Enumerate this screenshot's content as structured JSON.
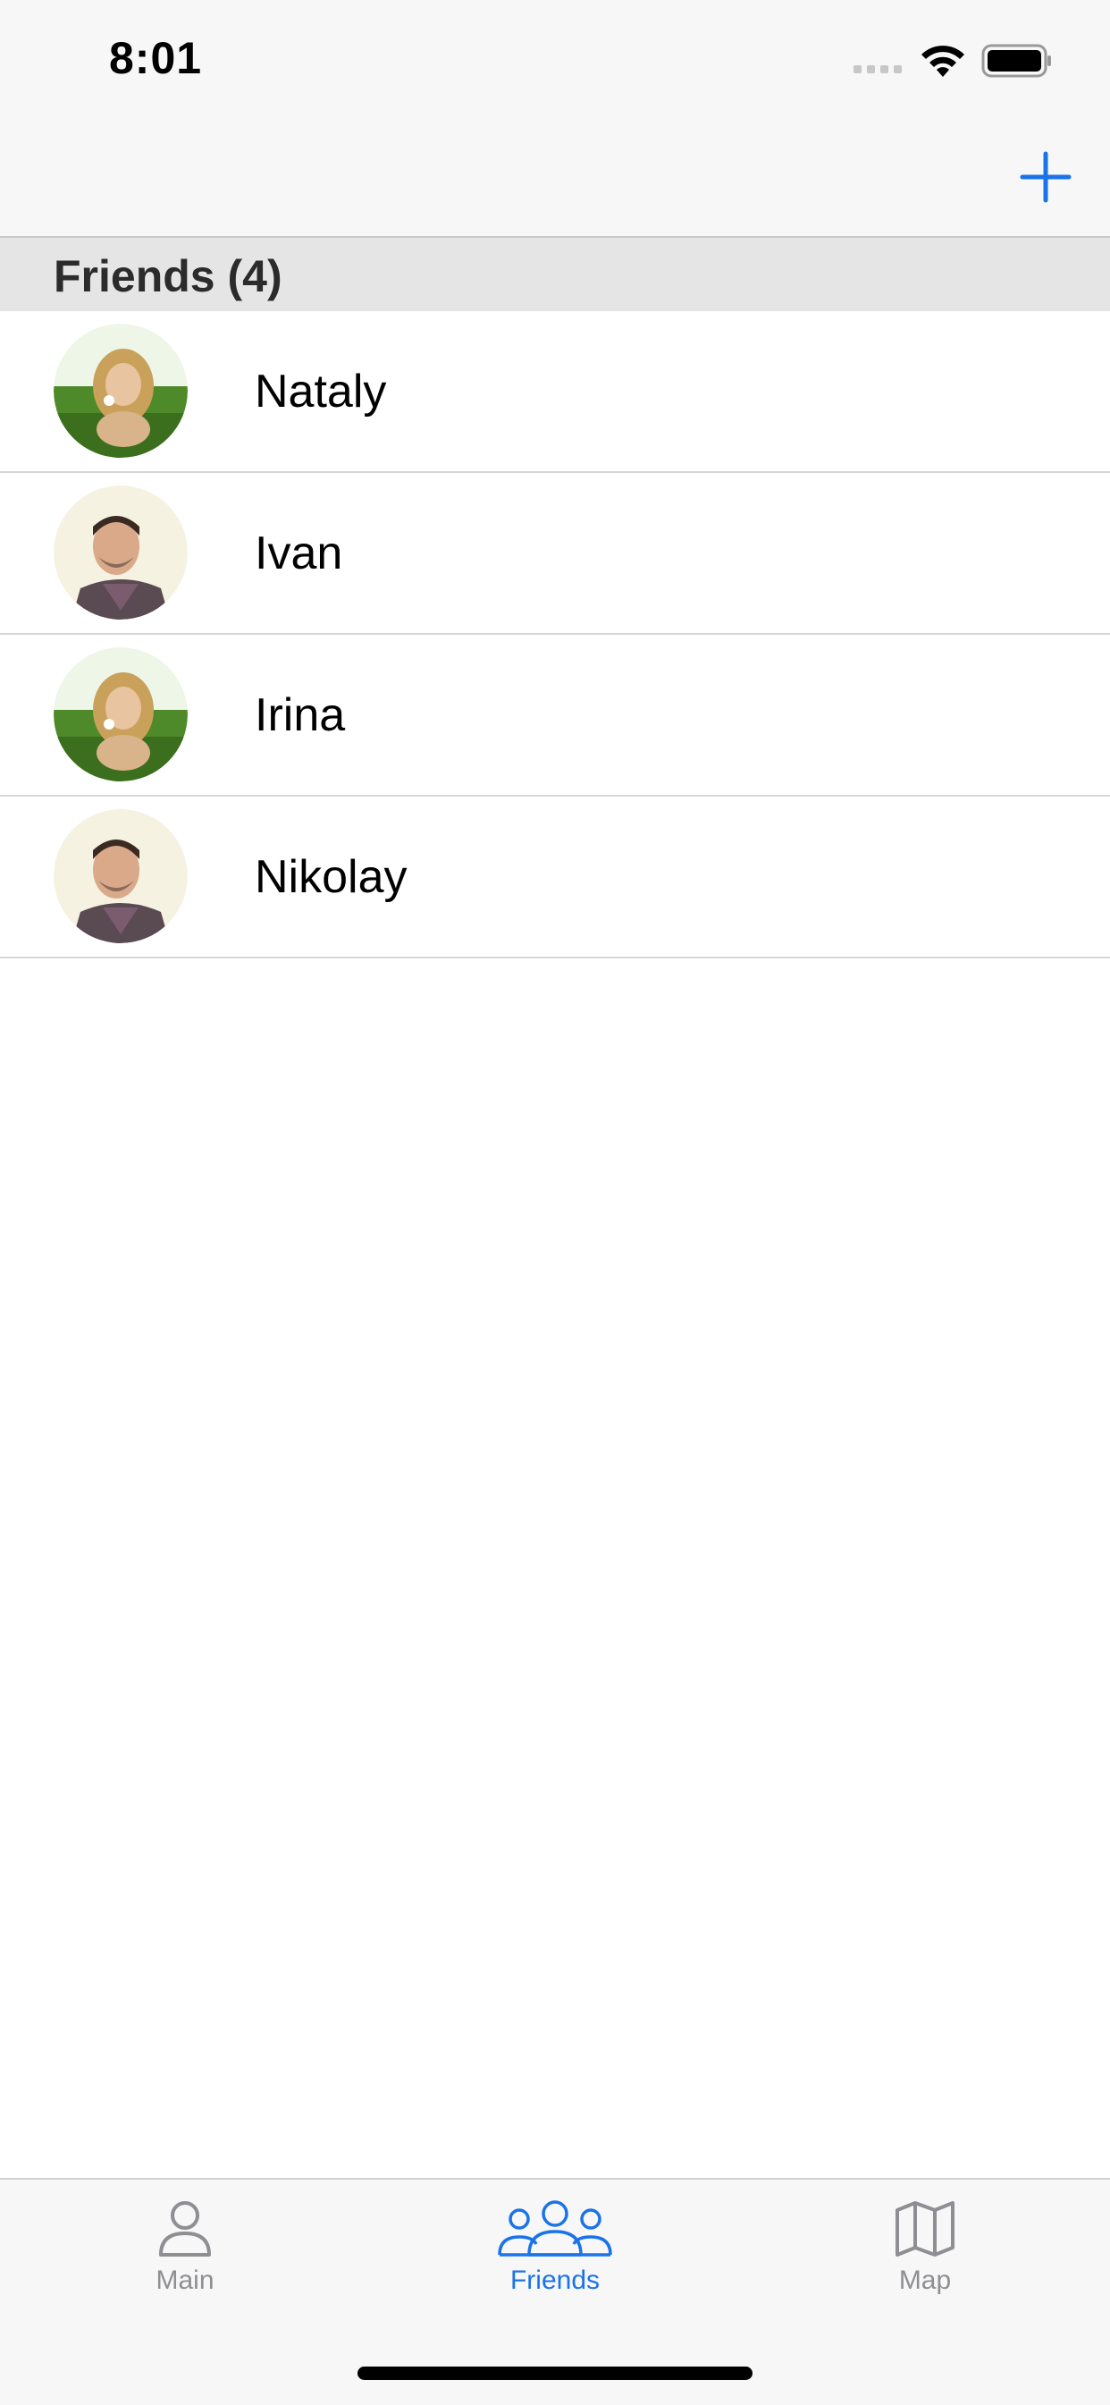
{
  "status_bar": {
    "time": "8:01"
  },
  "nav": {
    "add_icon": "plus-icon"
  },
  "section": {
    "title": "Friends (4)"
  },
  "friends": [
    {
      "name": "Nataly",
      "avatar": "woman-portrait-avatar"
    },
    {
      "name": "Ivan",
      "avatar": "man-portrait-avatar"
    },
    {
      "name": "Irina",
      "avatar": "woman-portrait-avatar"
    },
    {
      "name": "Nikolay",
      "avatar": "man-portrait-avatar"
    }
  ],
  "tab_bar": {
    "tabs": [
      {
        "label": "Main",
        "icon": "person-icon",
        "selected": false
      },
      {
        "label": "Friends",
        "icon": "people-icon",
        "selected": true
      },
      {
        "label": "Map",
        "icon": "map-icon",
        "selected": false
      }
    ]
  },
  "colors": {
    "accent": "#1a73e8",
    "inactive": "#8e8e93"
  }
}
